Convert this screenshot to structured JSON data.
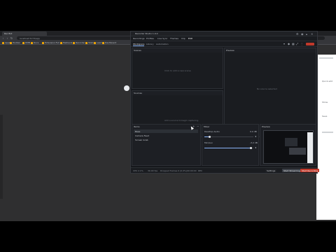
{
  "browser": {
    "tab_title": "Rec Bot",
    "address": "localhost:5173/app",
    "bookmarks": [
      "Apps",
      "Toolbar",
      "DMB",
      "Docs",
      "Extension Full",
      "Mediaviz",
      "Recorder",
      "Status",
      "Learn",
      "Dashboard"
    ]
  },
  "right_page": {
    "lines": [
      "Quick add",
      "Show",
      "Save"
    ]
  },
  "app": {
    "title": "Recorder Studio 1.0.0",
    "menu": [
      "Recordings",
      "Profiles",
      "Live Sync",
      "Themes",
      "Clip",
      "Edit"
    ],
    "tabs": [
      "Workspace",
      "Library",
      "Automation"
    ],
    "record_label": "",
    "panels": {
      "scenes": {
        "title": "Scenes",
        "hint": "Click to add a new scene."
      },
      "preview": {
        "title": "Preview",
        "hint": "No source selected"
      },
      "sources": {
        "title": "Sources",
        "hint": "Add a source to begin capturing."
      },
      "mixer": {
        "title": "Audio Mixer",
        "hint": ""
      },
      "items": {
        "title": "Items",
        "rows": [
          "Base",
          "Camera Feed",
          "Screen Grab"
        ]
      },
      "audio": {
        "title": "Mixer",
        "channels": [
          {
            "name": "Desktop Audio",
            "value": "0.0 dB",
            "level": 0.1
          },
          {
            "name": "Mic/Aux",
            "value": "-3.2 dB",
            "level": 0.95
          }
        ]
      },
      "transitions": {
        "title": "Preview"
      }
    },
    "status": [
      "CPU 2.1%",
      "30.00 fps",
      "Dropped frames 0 (0.0%)",
      "00:00:00",
      "REC"
    ],
    "status_buttons": {
      "settings": "Settings",
      "start_stream": "Start Streaming",
      "start_record": "Start Recording"
    },
    "colors": {
      "accent": "#8ab4f8",
      "record": "#c0392b"
    }
  }
}
